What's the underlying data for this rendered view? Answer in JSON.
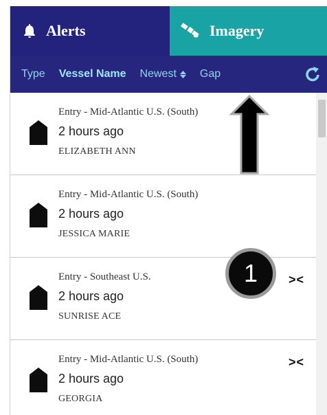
{
  "tabs": {
    "alerts": {
      "label": "Alerts",
      "icon": "bell-icon"
    },
    "imagery": {
      "label": "Imagery",
      "icon": "satellite-icon"
    }
  },
  "filters": {
    "type": "Type",
    "vessel_name": "Vessel Name",
    "newest": "Newest",
    "gap": "Gap"
  },
  "alerts": [
    {
      "event": "Entry - Mid-Atlantic U.S. (South)",
      "time": "2 hours ago",
      "vessel": "ELIZABETH ANN",
      "gap": false
    },
    {
      "event": "Entry - Mid-Atlantic U.S. (South)",
      "time": "2 hours ago",
      "vessel": "JESSICA MARIE",
      "gap": false
    },
    {
      "event": "Entry - Southeast U.S.",
      "time": "2 hours ago",
      "vessel": "SUNRISE ACE",
      "gap": true
    },
    {
      "event": "Entry - Mid-Atlantic U.S. (South)",
      "time": "2 hours ago",
      "vessel": "GEORGIA",
      "gap": true
    }
  ],
  "gap_symbol": "><",
  "callout": {
    "number": "1"
  },
  "colors": {
    "alerts_tab": "#23237e",
    "imagery_tab": "#1aa3a5",
    "filter_bar": "#26267f",
    "filter_text": "#8fd6e6"
  }
}
